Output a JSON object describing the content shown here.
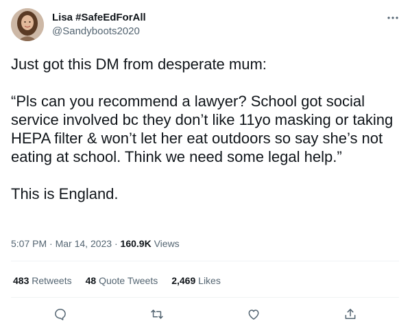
{
  "author": {
    "display_name": "Lisa #SafeEdForAll",
    "handle": "@Sandyboots2020"
  },
  "tweet": {
    "line1": "Just got this DM from desperate mum:",
    "line2": "“Pls can you recommend a lawyer? School got social service involved bc they don’t like 11yo masking or taking HEPA filter & won’t let her eat outdoors so say she’s not eating at school. Think we need some legal help.”",
    "line3": "This is England."
  },
  "meta": {
    "time": "5:07 PM",
    "separator1": "·",
    "date": "Mar 14, 2023",
    "separator2": "·",
    "views_count": "160.9K",
    "views_label": "Views"
  },
  "stats": {
    "retweets_count": "483",
    "retweets_label": "Retweets",
    "quotes_count": "48",
    "quotes_label": "Quote Tweets",
    "likes_count": "2,469",
    "likes_label": "Likes"
  },
  "icons": {
    "more": "more-icon",
    "reply": "reply-icon",
    "retweet": "retweet-icon",
    "like": "heart-icon",
    "share": "share-icon"
  },
  "colors": {
    "text_primary": "#0f1419",
    "text_secondary": "#536471",
    "divider": "#eff3f4"
  }
}
